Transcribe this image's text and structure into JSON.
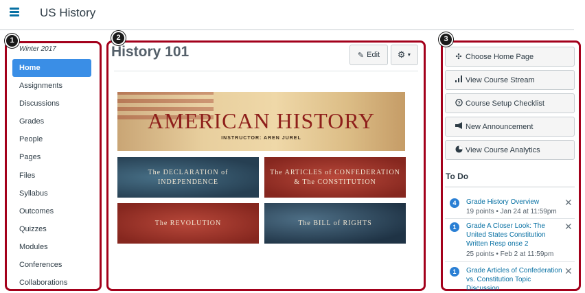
{
  "header": {
    "title": "US History"
  },
  "sidebar": {
    "term": "Winter 2017",
    "items": [
      {
        "label": "Home"
      },
      {
        "label": "Assignments"
      },
      {
        "label": "Discussions"
      },
      {
        "label": "Grades"
      },
      {
        "label": "People"
      },
      {
        "label": "Pages"
      },
      {
        "label": "Files"
      },
      {
        "label": "Syllabus"
      },
      {
        "label": "Outcomes"
      },
      {
        "label": "Quizzes"
      },
      {
        "label": "Modules"
      },
      {
        "label": "Conferences"
      },
      {
        "label": "Collaborations"
      }
    ]
  },
  "badges": {
    "one": "1",
    "two": "2",
    "three": "3"
  },
  "main": {
    "title": "History 101",
    "edit_label": "Edit",
    "banner_title": "AMERICAN HISTORY",
    "banner_sub": "INSTRUCTOR: AREN JUREL",
    "tiles": [
      {
        "line1": "The DECLARATION of INDEPENDENCE",
        "line2": ""
      },
      {
        "line1": "The ARTICLES of CONFEDERATION",
        "line2": "& The CONSTITUTION"
      },
      {
        "line1": "The REVOLUTION",
        "line2": ""
      },
      {
        "line1": "The BILL of RIGHTS",
        "line2": ""
      }
    ]
  },
  "right": {
    "buttons": [
      {
        "label": "Choose Home Page",
        "icon": "target-icon"
      },
      {
        "label": "View Course Stream",
        "icon": "bar-chart-icon"
      },
      {
        "label": "Course Setup Checklist",
        "icon": "question-circle-icon"
      },
      {
        "label": "New Announcement",
        "icon": "megaphone-icon"
      },
      {
        "label": "View Course Analytics",
        "icon": "analytics-icon"
      }
    ],
    "todo_heading": "To Do",
    "todo": [
      {
        "count": "4",
        "title": "Grade History Overview",
        "meta": "19 points • Jan 24 at 11:59pm"
      },
      {
        "count": "1",
        "title": "Grade A Closer Look: The United States Constitution Written Resp onse 2",
        "meta": "25 points • Feb 2 at 11:59pm"
      },
      {
        "count": "1",
        "title": "Grade Articles of Confederation vs. Constitution Topic Discussion",
        "meta": ""
      }
    ]
  },
  "colors": {
    "accent": "#3a8ee6",
    "highlight_border": "#a3001b",
    "link": "#0770a3"
  }
}
